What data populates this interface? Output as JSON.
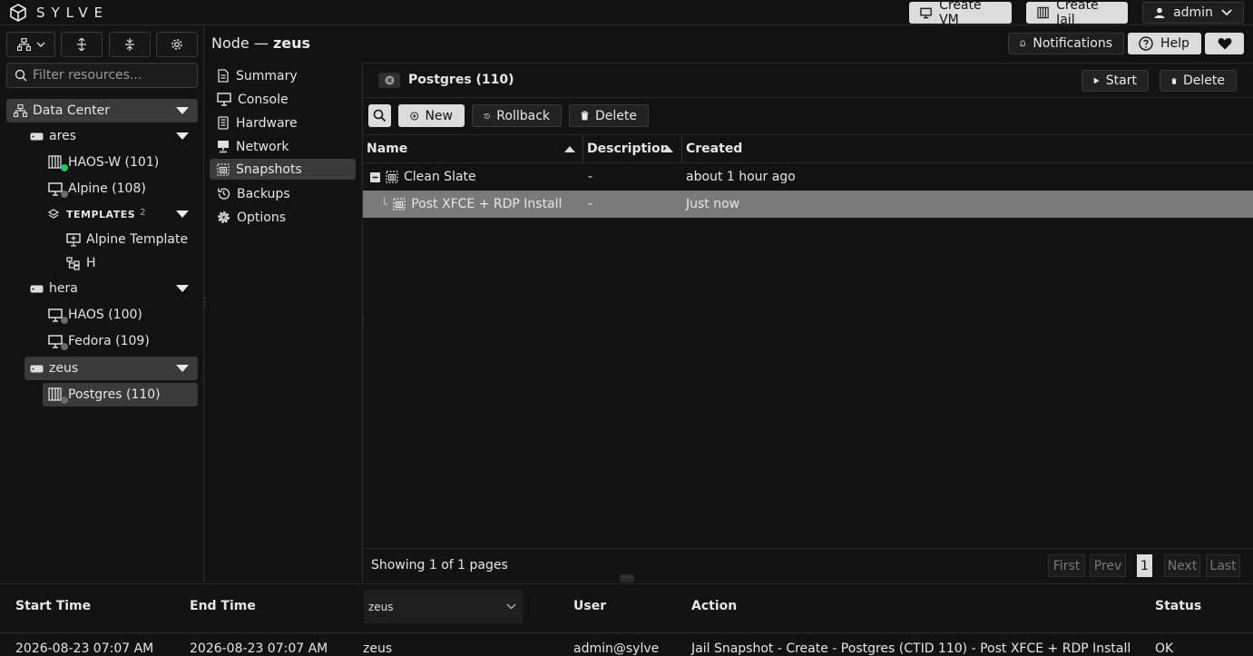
{
  "app": {
    "name": "SYLVE"
  },
  "topbar": {
    "create_vm": "Create VM",
    "create_jail": "Create Jail",
    "user": "admin"
  },
  "header": {
    "node_prefix": "Node —",
    "node_name": "zeus",
    "notifications": "Notifications",
    "help": "Help"
  },
  "sidebar": {
    "filter_placeholder": "Filter resources...",
    "datacenter": "Data Center",
    "nodes": [
      {
        "name": "ares",
        "items": [
          {
            "label": "HAOS-W (101)",
            "status": "running"
          },
          {
            "label": "Alpine (108)",
            "status": "stopped"
          }
        ],
        "templates": {
          "label": "TEMPLATES",
          "count": "2",
          "items": [
            "Alpine Template",
            "H"
          ]
        }
      },
      {
        "name": "hera",
        "items": [
          {
            "label": "HAOS (100)",
            "status": "stopped"
          },
          {
            "label": "Fedora (109)",
            "status": "stopped"
          }
        ]
      },
      {
        "name": "zeus",
        "items": [
          {
            "label": "Postgres (110)",
            "status": "stopped"
          }
        ]
      }
    ]
  },
  "nav": {
    "items": [
      "Summary",
      "Console",
      "Hardware",
      "Network",
      "Snapshots",
      "Backups",
      "Options"
    ],
    "active": "Snapshots"
  },
  "panel": {
    "title": "Postgres (110)",
    "start": "Start",
    "delete": "Delete",
    "toolbar": {
      "new": "New",
      "rollback": "Rollback",
      "delete": "Delete"
    },
    "columns": [
      "Name",
      "Description",
      "Created"
    ],
    "rows": [
      {
        "name": "Clean Slate",
        "description": "-",
        "created": "about 1 hour ago"
      },
      {
        "name": "Post XFCE + RDP Install",
        "description": "-",
        "created": "Just now"
      }
    ],
    "footer": {
      "showing": "Showing 1 of 1 pages",
      "first": "First",
      "prev": "Prev",
      "page": "1",
      "next": "Next",
      "last": "Last"
    }
  },
  "audit": {
    "columns": {
      "start": "Start Time",
      "end": "End Time",
      "node_select": "zeus",
      "user": "User",
      "action": "Action",
      "status": "Status"
    },
    "row": {
      "start": "2026-08-23 07:07 AM",
      "end": "2026-08-23 07:07 AM",
      "node": "zeus",
      "user": "admin@sylve",
      "action": "Jail Snapshot - Create - Postgres (CTID 110) - Post XFCE + RDP Install",
      "status": "OK"
    }
  },
  "colors": {
    "accent_selected_row": "#7a7a7a",
    "running": "#22c55e",
    "stopped": "#6b6b6b"
  }
}
